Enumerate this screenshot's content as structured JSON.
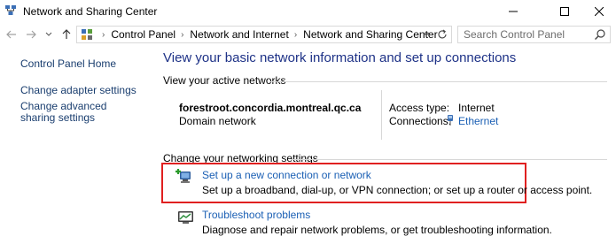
{
  "window": {
    "title": "Network and Sharing Center"
  },
  "address": {
    "breadcrumbs": [
      "Control Panel",
      "Network and Internet",
      "Network and Sharing Center"
    ],
    "separator": "›"
  },
  "search": {
    "placeholder": "Search Control Panel",
    "value": ""
  },
  "sidebar": {
    "items": [
      {
        "label": "Control Panel Home"
      },
      {
        "label": "Change adapter settings"
      },
      {
        "label": "Change advanced sharing settings"
      }
    ]
  },
  "main": {
    "title": "View your basic network information and set up connections",
    "active_networks_heading": "View your active networks",
    "network": {
      "name": "forestroot.concordia.montreal.qc.ca",
      "type": "Domain network",
      "access_type_label": "Access type:",
      "access_type_value": "Internet",
      "connections_label": "Connections:",
      "connection_value": "Ethernet"
    },
    "change_heading": "Change your networking settings",
    "tasks": [
      {
        "label": "Set up a new connection or network",
        "description": "Set up a broadband, dial-up, or VPN connection; or set up a router or access point.",
        "icon": "new-connection-icon"
      },
      {
        "label": "Troubleshoot problems",
        "description": "Diagnose and repair network problems, or get troubleshooting information.",
        "icon": "troubleshoot-icon"
      }
    ]
  },
  "colors": {
    "link": "#1a5fb4",
    "title": "#1e3287",
    "highlight": "#e02020"
  }
}
